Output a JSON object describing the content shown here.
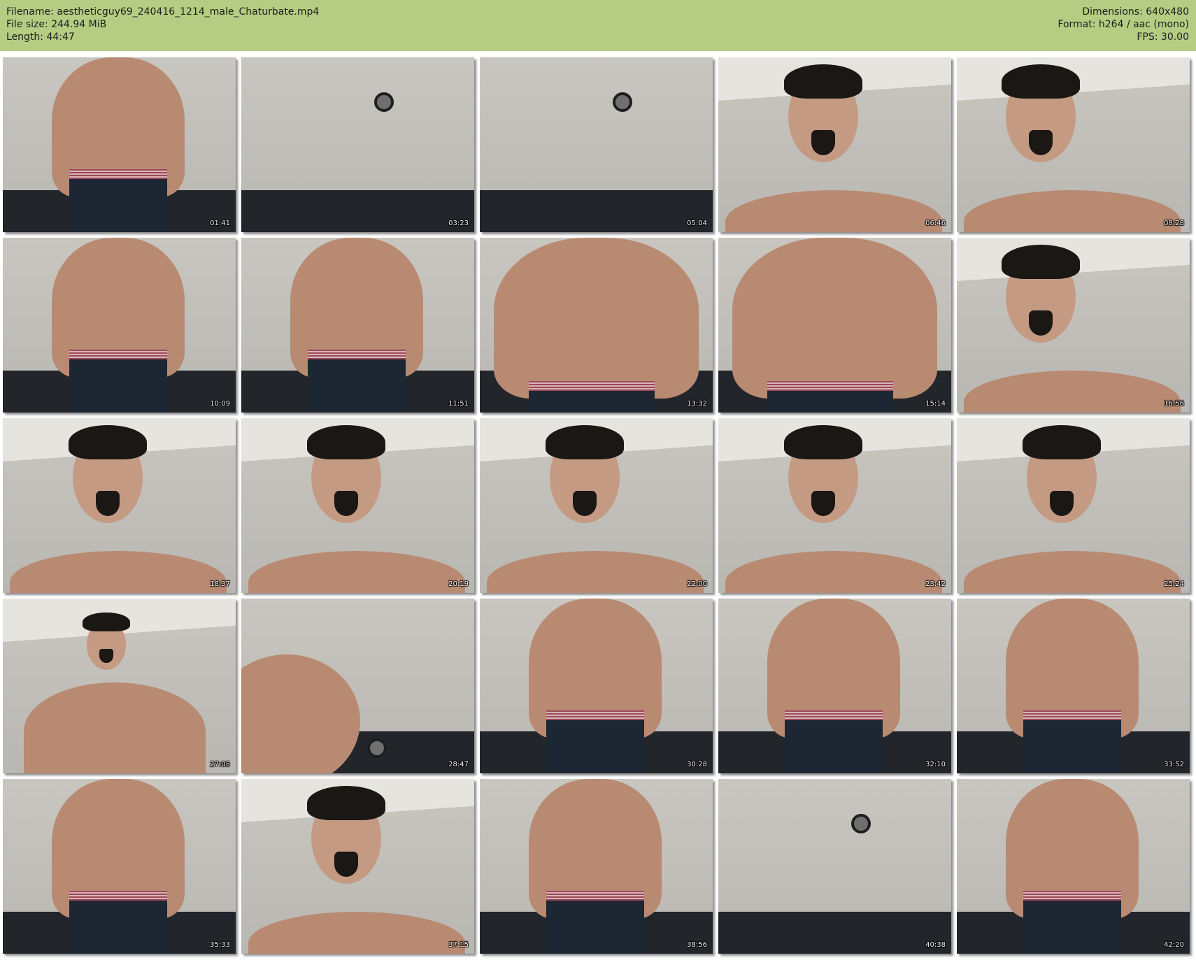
{
  "header": {
    "filename_label": "Filename:",
    "filename": "aestheticguy69_240416_1214_male_Chaturbate.mp4",
    "filesize_label": "File size:",
    "filesize": "244.94 MiB",
    "length_label": "Length:",
    "length": "44:47",
    "dimensions_label": "Dimensions:",
    "dimensions": "640x480",
    "format_label": "Format:",
    "format": "h264 / aac (mono)",
    "fps_label": "FPS:",
    "fps": "30.00"
  },
  "colors": {
    "header_bg": "#b4cd82",
    "skin": "#b98a72",
    "wall": "#c9c6c0",
    "ceiling": "#e6e4df",
    "couch": "#22262b",
    "waistband": "#9b4a58",
    "pants": "#1d2733",
    "hair": "#1a1715"
  },
  "thumbnails": [
    {
      "time": "01:41",
      "scene": "torso-clock"
    },
    {
      "time": "03:23",
      "scene": "empty-clock"
    },
    {
      "time": "05:04",
      "scene": "empty-clock"
    },
    {
      "time": "06:46",
      "scene": "face"
    },
    {
      "time": "08:28",
      "scene": "face-side"
    },
    {
      "time": "10:09",
      "scene": "torso-phone"
    },
    {
      "time": "11:51",
      "scene": "torso"
    },
    {
      "time": "13:32",
      "scene": "torso-close"
    },
    {
      "time": "15:14",
      "scene": "torso-close"
    },
    {
      "time": "16:56",
      "scene": "face-side"
    },
    {
      "time": "18:37",
      "scene": "face"
    },
    {
      "time": "20:19",
      "scene": "face"
    },
    {
      "time": "22:00",
      "scene": "face"
    },
    {
      "time": "23:42",
      "scene": "face"
    },
    {
      "time": "25:24",
      "scene": "face"
    },
    {
      "time": "27:05",
      "scene": "face-far"
    },
    {
      "time": "28:47",
      "scene": "shoulder-clock"
    },
    {
      "time": "30:28",
      "scene": "torso"
    },
    {
      "time": "32:10",
      "scene": "torso"
    },
    {
      "time": "33:52",
      "scene": "torso-clock"
    },
    {
      "time": "35:33",
      "scene": "torso"
    },
    {
      "time": "37:15",
      "scene": "face"
    },
    {
      "time": "38:56",
      "scene": "torso"
    },
    {
      "time": "40:38",
      "scene": "empty-clock"
    },
    {
      "time": "42:20",
      "scene": "torso"
    }
  ]
}
